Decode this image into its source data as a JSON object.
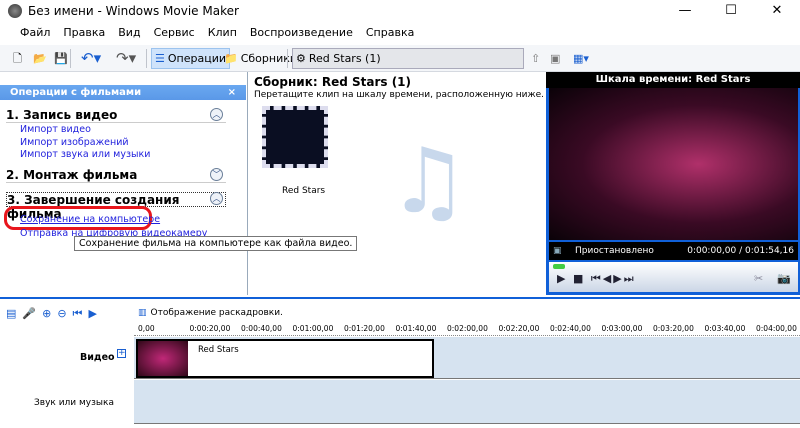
{
  "window": {
    "title": "Без имени - Windows Movie Maker",
    "minimize": "—",
    "maximize": "☐",
    "close": "✕"
  },
  "menu": [
    "Файл",
    "Правка",
    "Вид",
    "Сервис",
    "Клип",
    "Воспроизведение",
    "Справка"
  ],
  "toolbar": {
    "operations": "Операции",
    "collections": "Сборники",
    "collection_select": "Red Stars (1)"
  },
  "tasks": {
    "header": "Операции с фильмами",
    "close": "×",
    "sections": [
      {
        "title": "1. Запись видео",
        "links": [
          "Импорт видео",
          "Импорт изображений",
          "Импорт звука или музыки"
        ]
      },
      {
        "title": "2. Монтаж фильма",
        "links": []
      },
      {
        "title": "3. Завершение создания фильма",
        "links": [
          "Сохранение на компьютере",
          "Отправка на цифровую видеокамеру"
        ]
      }
    ],
    "tooltip": "Сохранение фильма на компьютере как файла видео."
  },
  "collection": {
    "title": "Сборник: Red Stars (1)",
    "hint": "Перетащите клип на шкалу времени, расположенную ниже.",
    "clip_label": "Red Stars"
  },
  "preview": {
    "title": "Шкала времени: Red Stars",
    "status": "Приостановлено",
    "time": "0:00:00,00 / 0:01:54,16",
    "progress": 0
  },
  "timeline": {
    "mode_label": "Отображение раскадровки.",
    "ticks": [
      "0,00",
      "0:00:20,00",
      "0:00:40,00",
      "0:01:00,00",
      "0:01:20,00",
      "0:01:40,00",
      "0:02:00,00",
      "0:02:20,00",
      "0:02:40,00",
      "0:03:00,00",
      "0:03:20,00",
      "0:03:40,00",
      "0:04:00,00"
    ],
    "video_track": "Видео",
    "audio_track": "Звук или музыка",
    "clip_title": "Red Stars",
    "expand": "+"
  }
}
